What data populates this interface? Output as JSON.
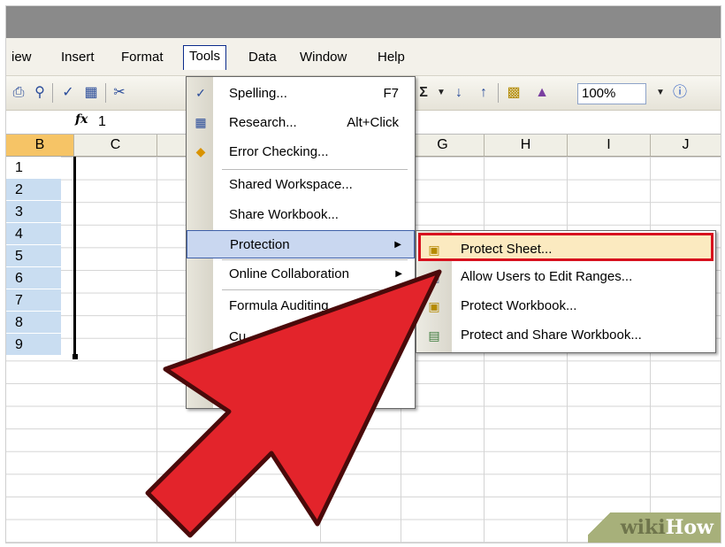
{
  "menubar": {
    "items": [
      "iew",
      "Insert",
      "Format",
      "Tools",
      "Data",
      "Window",
      "Help"
    ],
    "active": "Tools"
  },
  "toolbar": {
    "zoom": "100%",
    "icons": [
      "print-icon",
      "print-preview-icon",
      "spelling-icon",
      "research-icon",
      "cut-icon",
      "autosum-icon",
      "sort-ascending-icon",
      "sort-descending-icon",
      "chart-wizard-icon",
      "drawing-icon",
      "help-icon"
    ]
  },
  "formula_bar": {
    "fx_label": "fx",
    "value": "1"
  },
  "columns": [
    "B",
    "C",
    "",
    "",
    "",
    "G",
    "H",
    "I",
    "J"
  ],
  "selected_column": "B",
  "rows": [
    "1",
    "2",
    "3",
    "4",
    "5",
    "6",
    "7",
    "8",
    "9"
  ],
  "tools_menu": {
    "items": [
      {
        "label": "Spelling...",
        "shortcut": "F7",
        "icon": "spelling-icon"
      },
      {
        "label": "Research...",
        "shortcut": "Alt+Click",
        "icon": "research-icon"
      },
      {
        "label": "Error Checking...",
        "shortcut": "",
        "icon": "error-checking-icon"
      },
      {
        "label": "Shared Workspace...",
        "shortcut": ""
      },
      {
        "label": "Share Workbook...",
        "shortcut": ""
      },
      {
        "label": "Protection",
        "submenu": true
      },
      {
        "label": "Online Collaboration",
        "submenu": true
      },
      {
        "label": "Formula Auditing",
        "submenu": true
      },
      {
        "label": "Cu",
        "shortcut": ""
      }
    ]
  },
  "protection_submenu": {
    "items": [
      {
        "label": "Protect Sheet...",
        "icon": "protect-sheet-icon",
        "highlighted": true
      },
      {
        "label": "Allow Users to Edit Ranges...",
        "icon": "allow-users-icon"
      },
      {
        "label": "Protect Workbook...",
        "icon": "protect-workbook-icon"
      },
      {
        "label": "Protect and Share Workbook...",
        "icon": "protect-share-icon"
      }
    ]
  },
  "colors": {
    "highlight_border": "#d7111e",
    "pointer": "#e3242b",
    "selected_header": "#f6c466"
  },
  "watermark": {
    "part1": "wiki",
    "part2": "How"
  }
}
